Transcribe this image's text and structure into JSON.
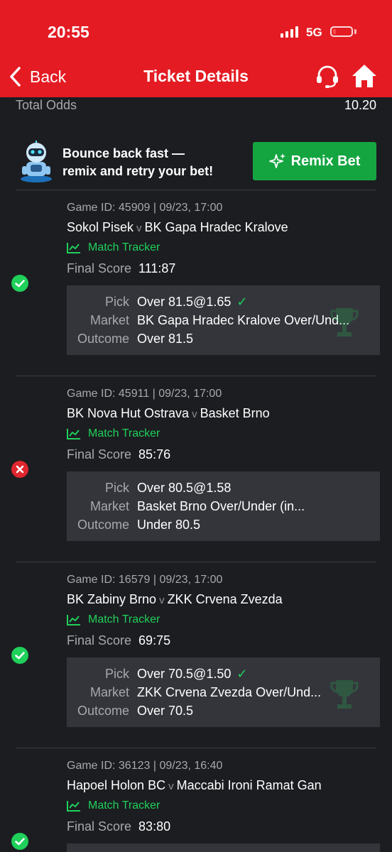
{
  "status_bar": {
    "time": "20:55",
    "network": "5G"
  },
  "header": {
    "back_label": "Back",
    "title": "Ticket Details",
    "support_icon": "headset-icon",
    "home_icon": "home-icon"
  },
  "total_odds": {
    "label": "Total Odds",
    "value": "10.20"
  },
  "promo": {
    "line1": "Bounce back fast —",
    "line2": "remix and retry your bet!",
    "button_label": "Remix Bet"
  },
  "colors": {
    "brand_red": "#e41b23",
    "win_green": "#1fd05a",
    "button_green": "#14a541",
    "lost_red": "#e0262e",
    "background": "#1c1d21",
    "pick_box": "#34353b"
  },
  "labels": {
    "match_tracker": "Match Tracker",
    "final_score": "Final Score",
    "pick": "Pick",
    "market": "Market",
    "outcome": "Outcome",
    "vs": "v"
  },
  "bets": [
    {
      "status": "won",
      "game_meta": "Game ID: 45909 | 09/23, 17:00",
      "home_team": "Sokol Pisek",
      "away_team": "BK Gapa Hradec Kralove",
      "final_score": "111:87",
      "pick": "Over 81.5@1.65",
      "market": "BK Gapa Hradec Kralove Over/Und...",
      "outcome": "Over 81.5"
    },
    {
      "status": "lost",
      "game_meta": "Game ID: 45911 | 09/23, 17:00",
      "home_team": "BK Nova Hut Ostrava",
      "away_team": "Basket Brno",
      "final_score": "85:76",
      "pick": "Over 80.5@1.58",
      "market": "Basket Brno Over/Under (in...",
      "outcome": "Under 80.5"
    },
    {
      "status": "won",
      "game_meta": "Game ID: 16579 | 09/23, 17:00",
      "home_team": "BK Zabiny Brno",
      "away_team": "ZKK Crvena Zvezda",
      "final_score": "69:75",
      "pick": "Over 70.5@1.50",
      "market": "ZKK Crvena Zvezda Over/Und...",
      "outcome": "Over 70.5"
    },
    {
      "status": "won",
      "game_meta": "Game ID: 36123 | 09/23, 16:40",
      "home_team": "Hapoel Holon BC",
      "away_team": "Maccabi Ironi Ramat Gan",
      "final_score": "83:80"
    }
  ]
}
